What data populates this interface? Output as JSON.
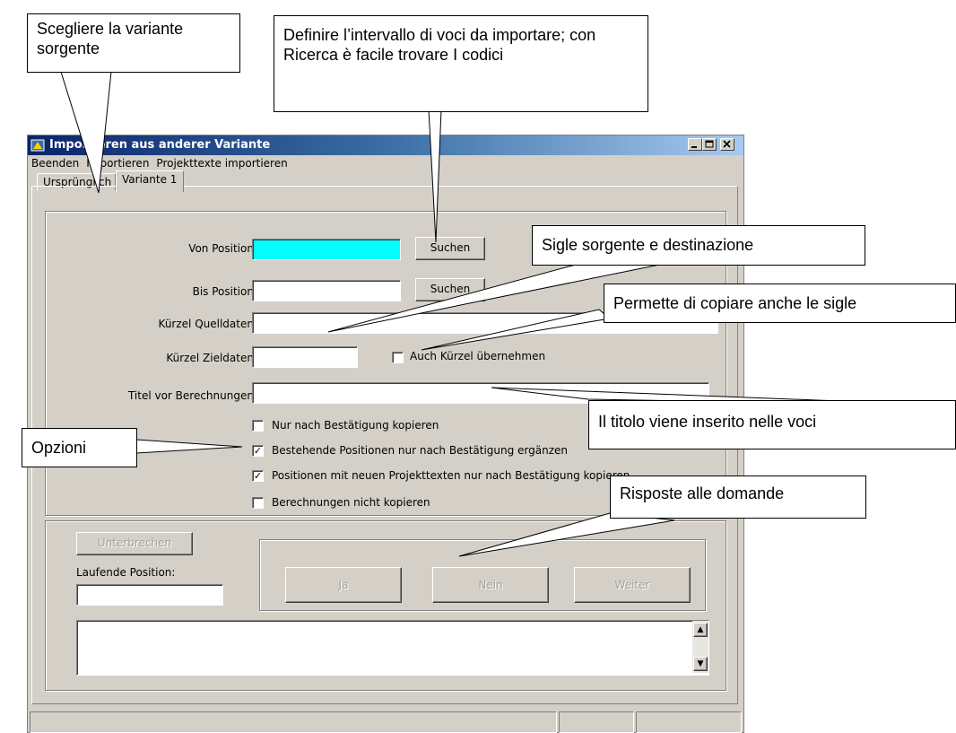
{
  "window": {
    "title": "Importieren aus anderer Variante",
    "menu": [
      "Beenden",
      "Importieren",
      "Projekttexte importieren"
    ],
    "tabs": [
      "Ursprünglich",
      "Variante 1"
    ],
    "active_tab": "Variante 1"
  },
  "form": {
    "von_position_label": "Von Position:",
    "von_position_value": "",
    "bis_position_label": "Bis Position:",
    "bis_position_value": "",
    "search_label": "Suchen",
    "kuerzel_quelldaten_label": "Kürzel Quelldaten:",
    "kuerzel_zieldaten_label": "Kürzel Zieldaten:",
    "auch_kuerzel_label": "Auch Kürzel übernehmen",
    "titel_label": "Titel vor Berechnungen:",
    "options": [
      {
        "label": "Nur nach Bestätigung kopieren",
        "checked": false
      },
      {
        "label": "Bestehende Positionen nur nach Bestätigung ergänzen",
        "checked": true
      },
      {
        "label": "Positionen mit neuen Projekttexten nur nach Bestätigung kopieren",
        "checked": true
      },
      {
        "label": "Berechnungen nicht kopieren",
        "checked": false
      }
    ]
  },
  "bottom": {
    "interrupt_label": "Unterbrechen",
    "current_position_label": "Laufende Position:",
    "yes_label": "Ja",
    "no_label": "Nein",
    "next_label": "Weiter"
  },
  "callouts": {
    "source_variant": "Scegliere la variante sorgente",
    "range": "Definire l’intervallo di voci da importare; con Ricerca è facile trovare I codici",
    "sigle": "Sigle sorgente e destinazione",
    "copy_sigle": "Permette di copiare anche le sigle",
    "title_inserted": "Il titolo viene inserito nelle voci",
    "options": "Opzioni",
    "answers": "Risposte alle domande"
  }
}
